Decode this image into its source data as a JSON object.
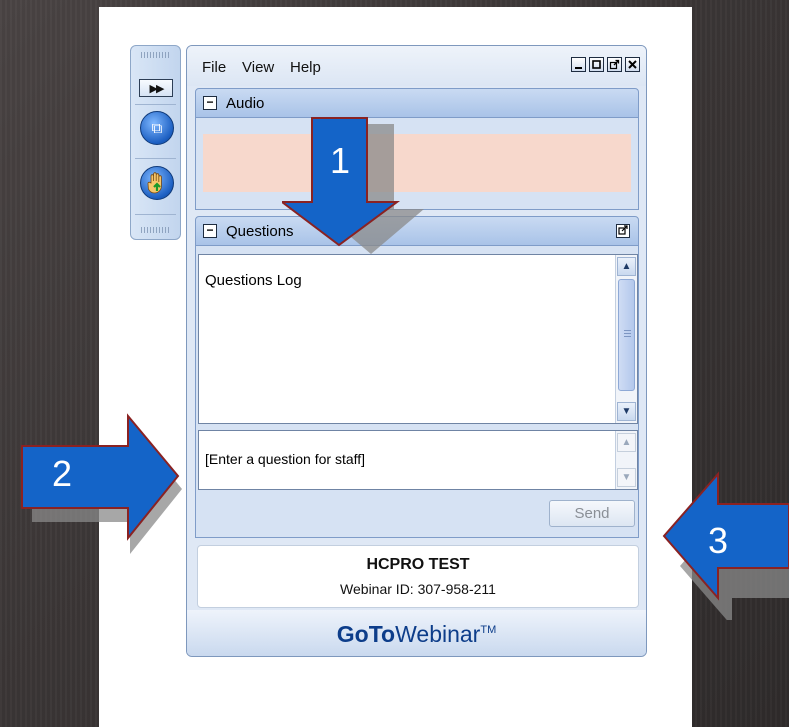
{
  "menu": {
    "file": "File",
    "view": "View",
    "help": "Help"
  },
  "window_controls": {
    "minimize": "_",
    "restore": "□",
    "popout": "⧉",
    "close": "✕"
  },
  "audio_panel": {
    "title": "Audio",
    "collapse_glyph": "−"
  },
  "questions_panel": {
    "title": "Questions",
    "collapse_glyph": "−",
    "log_title": "Questions Log",
    "input_placeholder": "[Enter a question for staff]",
    "send_label": "Send",
    "send_enabled": false
  },
  "webinar": {
    "name": "HCPRO TEST",
    "id_text": "Webinar ID: 307-958-211"
  },
  "brand": {
    "part1": "GoTo",
    "part2": "Webinar",
    "tm": "TM"
  },
  "annotations": [
    {
      "label": "1"
    },
    {
      "label": "2"
    },
    {
      "label": "3"
    }
  ],
  "colors": {
    "annotation_blue": "#1464c8",
    "audio_band": "#f7d8cc",
    "brand": "#0d3d8a"
  },
  "icons": {
    "side_ff": "fast-forward-icon",
    "side_popout": "popout-window-icon",
    "side_raise_hand": "raise-hand-icon"
  }
}
